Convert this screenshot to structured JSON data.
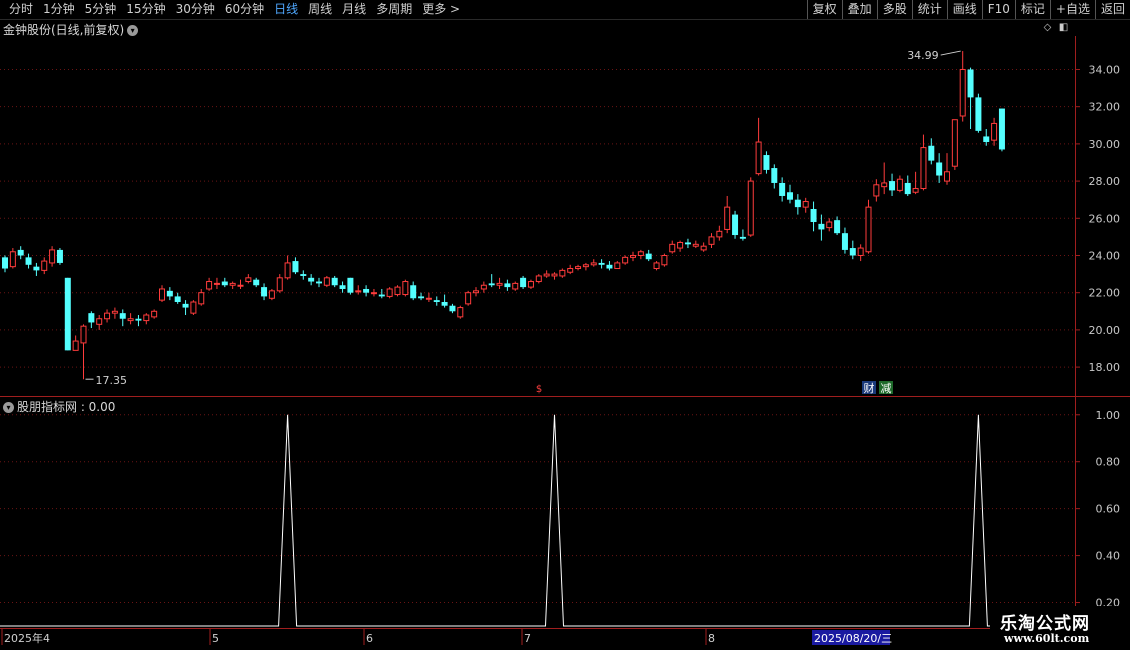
{
  "toolbar": {
    "periods": [
      "分时",
      "1分钟",
      "5分钟",
      "15分钟",
      "30分钟",
      "60分钟",
      "日线",
      "周线",
      "月线",
      "多周期",
      "更多 >"
    ],
    "active_period": "日线",
    "tools": [
      "复权",
      "叠加",
      "多股",
      "统计",
      "画线",
      "F10",
      "标记",
      "+自选",
      "返回"
    ]
  },
  "main_title": "金钟股份(日线,前复权)",
  "indicator_title": "股朋指标网 : 0.00",
  "price_axis": {
    "min": 16.5,
    "max": 35.8,
    "ticks": [
      "34.00",
      "32.00",
      "30.00",
      "28.00",
      "26.00",
      "24.00",
      "22.00",
      "20.00",
      "18.00"
    ]
  },
  "indicator_axis": {
    "min": 0.1,
    "max": 1.08,
    "ticks": [
      "1.00",
      "0.80",
      "0.60",
      "0.40",
      "0.20"
    ]
  },
  "high_label": "34.99",
  "low_label": "17.35",
  "markers": {
    "dollar": "$",
    "cai": "财",
    "jian": "减"
  },
  "date_axis": {
    "labels": [
      "2025年4",
      "5",
      "6",
      "7",
      "8"
    ],
    "cursor_date": "2025/08/20/三"
  },
  "colors": {
    "up": "#ff3c3c",
    "down": "#54ffff",
    "grid": "#6a1414",
    "axis": "#a01e1e",
    "signal": "#ffffff",
    "active": "#4fa8ff"
  },
  "chart_data": {
    "type": "candlestick",
    "ohlc": [
      [
        23.9,
        24.0,
        23.1,
        23.3
      ],
      [
        23.4,
        24.4,
        23.3,
        24.2
      ],
      [
        24.3,
        24.5,
        23.8,
        24.0
      ],
      [
        23.9,
        24.1,
        23.3,
        23.5
      ],
      [
        23.4,
        23.6,
        22.9,
        23.2
      ],
      [
        23.2,
        23.9,
        23.0,
        23.7
      ],
      [
        23.6,
        24.5,
        23.4,
        24.3
      ],
      [
        24.3,
        24.4,
        23.5,
        23.6
      ],
      [
        22.8,
        22.8,
        18.9,
        18.9
      ],
      [
        18.9,
        19.7,
        18.9,
        19.4
      ],
      [
        19.3,
        20.3,
        17.35,
        20.2
      ],
      [
        20.9,
        21.0,
        20.1,
        20.4
      ],
      [
        20.3,
        20.8,
        20.0,
        20.6
      ],
      [
        20.6,
        21.1,
        20.4,
        20.9
      ],
      [
        20.9,
        21.2,
        20.6,
        21.0
      ],
      [
        20.9,
        21.1,
        20.2,
        20.6
      ],
      [
        20.5,
        20.9,
        20.3,
        20.6
      ],
      [
        20.6,
        20.8,
        20.2,
        20.5
      ],
      [
        20.5,
        20.9,
        20.3,
        20.8
      ],
      [
        20.7,
        21.1,
        20.6,
        21.0
      ],
      [
        21.6,
        22.4,
        21.5,
        22.2
      ],
      [
        22.1,
        22.3,
        21.6,
        21.8
      ],
      [
        21.8,
        22.0,
        21.4,
        21.5
      ],
      [
        21.4,
        21.6,
        20.8,
        21.2
      ],
      [
        20.9,
        21.6,
        20.8,
        21.5
      ],
      [
        21.4,
        22.2,
        21.3,
        22.0
      ],
      [
        22.2,
        22.8,
        22.1,
        22.6
      ],
      [
        22.5,
        22.8,
        22.2,
        22.5
      ],
      [
        22.6,
        22.8,
        22.3,
        22.4
      ],
      [
        22.4,
        22.6,
        22.2,
        22.5
      ],
      [
        22.4,
        22.7,
        22.2,
        22.4
      ],
      [
        22.6,
        23.0,
        22.5,
        22.8
      ],
      [
        22.7,
        22.8,
        22.3,
        22.4
      ],
      [
        22.3,
        22.5,
        21.6,
        21.8
      ],
      [
        21.7,
        22.2,
        21.6,
        22.1
      ],
      [
        22.1,
        23.0,
        22.0,
        22.8
      ],
      [
        22.8,
        24.0,
        22.7,
        23.6
      ],
      [
        23.7,
        23.9,
        23.0,
        23.1
      ],
      [
        23.0,
        23.2,
        22.7,
        22.9
      ],
      [
        22.8,
        23.0,
        22.4,
        22.6
      ],
      [
        22.6,
        22.8,
        22.3,
        22.5
      ],
      [
        22.4,
        22.9,
        22.3,
        22.8
      ],
      [
        22.8,
        22.9,
        22.3,
        22.4
      ],
      [
        22.4,
        22.6,
        22.0,
        22.2
      ],
      [
        22.8,
        22.8,
        21.9,
        22.0
      ],
      [
        22.1,
        22.4,
        21.9,
        22.1
      ],
      [
        22.2,
        22.4,
        21.8,
        22.0
      ],
      [
        22.0,
        22.2,
        21.8,
        22.0
      ],
      [
        21.9,
        22.2,
        21.7,
        21.8
      ],
      [
        21.8,
        22.3,
        21.7,
        22.2
      ],
      [
        21.9,
        22.4,
        21.8,
        22.3
      ],
      [
        21.9,
        22.7,
        21.8,
        22.6
      ],
      [
        22.4,
        22.6,
        21.6,
        21.7
      ],
      [
        21.8,
        22.0,
        21.6,
        21.7
      ],
      [
        21.7,
        22.0,
        21.5,
        21.7
      ],
      [
        21.6,
        21.8,
        21.3,
        21.5
      ],
      [
        21.5,
        21.9,
        21.2,
        21.3
      ],
      [
        21.3,
        21.4,
        20.9,
        21.0
      ],
      [
        20.7,
        21.3,
        20.6,
        21.2
      ],
      [
        21.4,
        22.1,
        21.3,
        22.0
      ],
      [
        22.0,
        22.3,
        21.8,
        22.1
      ],
      [
        22.2,
        22.6,
        22.0,
        22.4
      ],
      [
        22.5,
        23.0,
        22.3,
        22.4
      ],
      [
        22.4,
        22.8,
        22.2,
        22.5
      ],
      [
        22.5,
        22.7,
        22.1,
        22.3
      ],
      [
        22.2,
        22.6,
        22.1,
        22.5
      ],
      [
        22.8,
        22.9,
        22.2,
        22.3
      ],
      [
        22.3,
        22.7,
        22.2,
        22.6
      ],
      [
        22.6,
        23.0,
        22.5,
        22.9
      ],
      [
        22.9,
        23.2,
        22.8,
        23.0
      ],
      [
        22.9,
        23.1,
        22.7,
        23.0
      ],
      [
        22.9,
        23.3,
        22.8,
        23.2
      ],
      [
        23.1,
        23.5,
        23.0,
        23.3
      ],
      [
        23.3,
        23.5,
        23.2,
        23.4
      ],
      [
        23.4,
        23.6,
        23.2,
        23.5
      ],
      [
        23.5,
        23.8,
        23.4,
        23.6
      ],
      [
        23.6,
        23.8,
        23.3,
        23.5
      ],
      [
        23.5,
        23.7,
        23.2,
        23.3
      ],
      [
        23.3,
        23.7,
        23.3,
        23.6
      ],
      [
        23.6,
        24.0,
        23.5,
        23.9
      ],
      [
        23.9,
        24.2,
        23.7,
        24.0
      ],
      [
        24.0,
        24.3,
        23.8,
        24.2
      ],
      [
        24.1,
        24.3,
        23.7,
        23.8
      ],
      [
        23.3,
        23.7,
        23.2,
        23.6
      ],
      [
        23.5,
        24.1,
        23.4,
        24.0
      ],
      [
        24.2,
        24.8,
        24.1,
        24.6
      ],
      [
        24.4,
        24.8,
        24.2,
        24.7
      ],
      [
        24.7,
        24.9,
        24.4,
        24.6
      ],
      [
        24.5,
        24.8,
        24.4,
        24.6
      ],
      [
        24.3,
        24.7,
        24.2,
        24.5
      ],
      [
        24.6,
        25.2,
        24.4,
        25.0
      ],
      [
        25.0,
        25.6,
        24.8,
        25.3
      ],
      [
        25.4,
        27.2,
        25.2,
        26.6
      ],
      [
        26.2,
        26.4,
        24.9,
        25.1
      ],
      [
        25.0,
        25.4,
        24.8,
        24.9
      ],
      [
        25.1,
        28.2,
        25.0,
        28.0
      ],
      [
        28.4,
        31.4,
        28.3,
        30.1
      ],
      [
        29.4,
        29.6,
        28.4,
        28.6
      ],
      [
        28.7,
        28.9,
        27.6,
        27.9
      ],
      [
        27.9,
        28.2,
        26.9,
        27.2
      ],
      [
        27.4,
        27.8,
        26.8,
        27.0
      ],
      [
        27.0,
        27.3,
        26.2,
        26.6
      ],
      [
        26.6,
        27.1,
        26.3,
        26.9
      ],
      [
        26.5,
        26.9,
        25.3,
        25.8
      ],
      [
        25.7,
        26.2,
        24.8,
        25.4
      ],
      [
        25.5,
        26.0,
        25.3,
        25.8
      ],
      [
        25.9,
        26.1,
        25.1,
        25.2
      ],
      [
        25.2,
        25.5,
        24.1,
        24.3
      ],
      [
        24.4,
        24.8,
        23.8,
        24.0
      ],
      [
        24.0,
        24.6,
        23.7,
        24.4
      ],
      [
        24.2,
        27.0,
        24.1,
        26.6
      ],
      [
        27.2,
        28.1,
        26.9,
        27.8
      ],
      [
        27.7,
        29.0,
        27.3,
        27.9
      ],
      [
        28.0,
        28.4,
        27.2,
        27.5
      ],
      [
        27.5,
        28.3,
        27.4,
        28.1
      ],
      [
        27.9,
        28.3,
        27.2,
        27.3
      ],
      [
        27.4,
        28.5,
        27.3,
        27.6
      ],
      [
        27.6,
        30.5,
        27.5,
        29.8
      ],
      [
        29.9,
        30.3,
        28.9,
        29.1
      ],
      [
        29.0,
        29.5,
        27.9,
        28.3
      ],
      [
        28.0,
        29.5,
        27.8,
        28.5
      ],
      [
        28.8,
        31.3,
        28.6,
        31.3
      ],
      [
        31.5,
        34.99,
        31.2,
        34.0
      ],
      [
        34.0,
        34.1,
        30.8,
        32.5
      ],
      [
        32.5,
        32.7,
        30.6,
        30.7
      ],
      [
        30.4,
        30.8,
        29.9,
        30.1
      ],
      [
        30.2,
        31.4,
        29.9,
        31.1
      ],
      [
        31.9,
        31.9,
        29.6,
        29.7
      ]
    ],
    "indicator": {
      "name": "股朋指标网",
      "spike_indices": [
        36,
        70,
        124
      ],
      "spike_value": 1.0
    }
  }
}
